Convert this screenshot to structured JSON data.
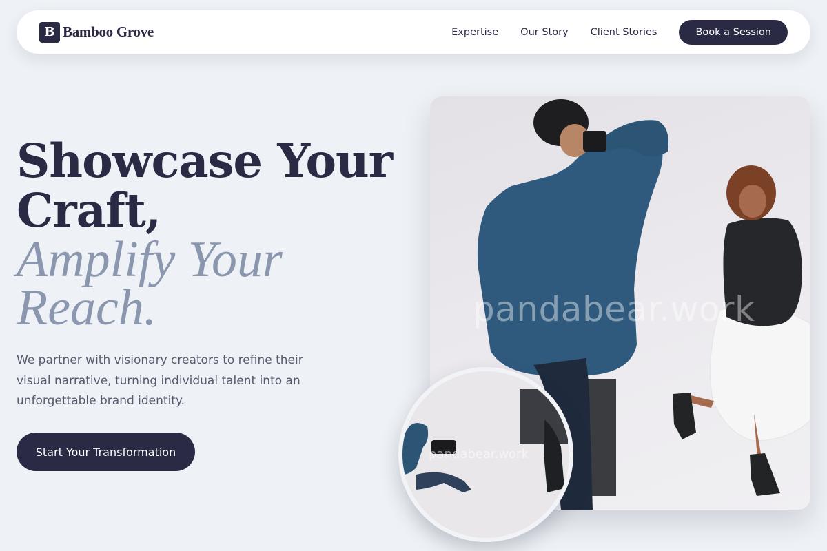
{
  "brand": {
    "mark": "B",
    "name": "Bamboo Grove"
  },
  "nav": {
    "links": [
      "Expertise",
      "Our Story",
      "Client Stories"
    ],
    "cta_label": "Book a Session"
  },
  "hero": {
    "headline_line1": "Showcase Your",
    "headline_line2": "Craft,",
    "accent_line1": "Amplify Your",
    "accent_line2": "Reach.",
    "subtext": "We partner with visionary creators to refine their visual narrative, turning individual talent into an unforgettable brand identity.",
    "cta_label": "Start Your Transformation"
  },
  "media": {
    "watermark": "pandabear.work",
    "inset_watermark": "pandabear.work"
  },
  "colors": {
    "primary": "#2a2a45",
    "accent_text": "#8a97ae",
    "background": "#eef1f5"
  }
}
